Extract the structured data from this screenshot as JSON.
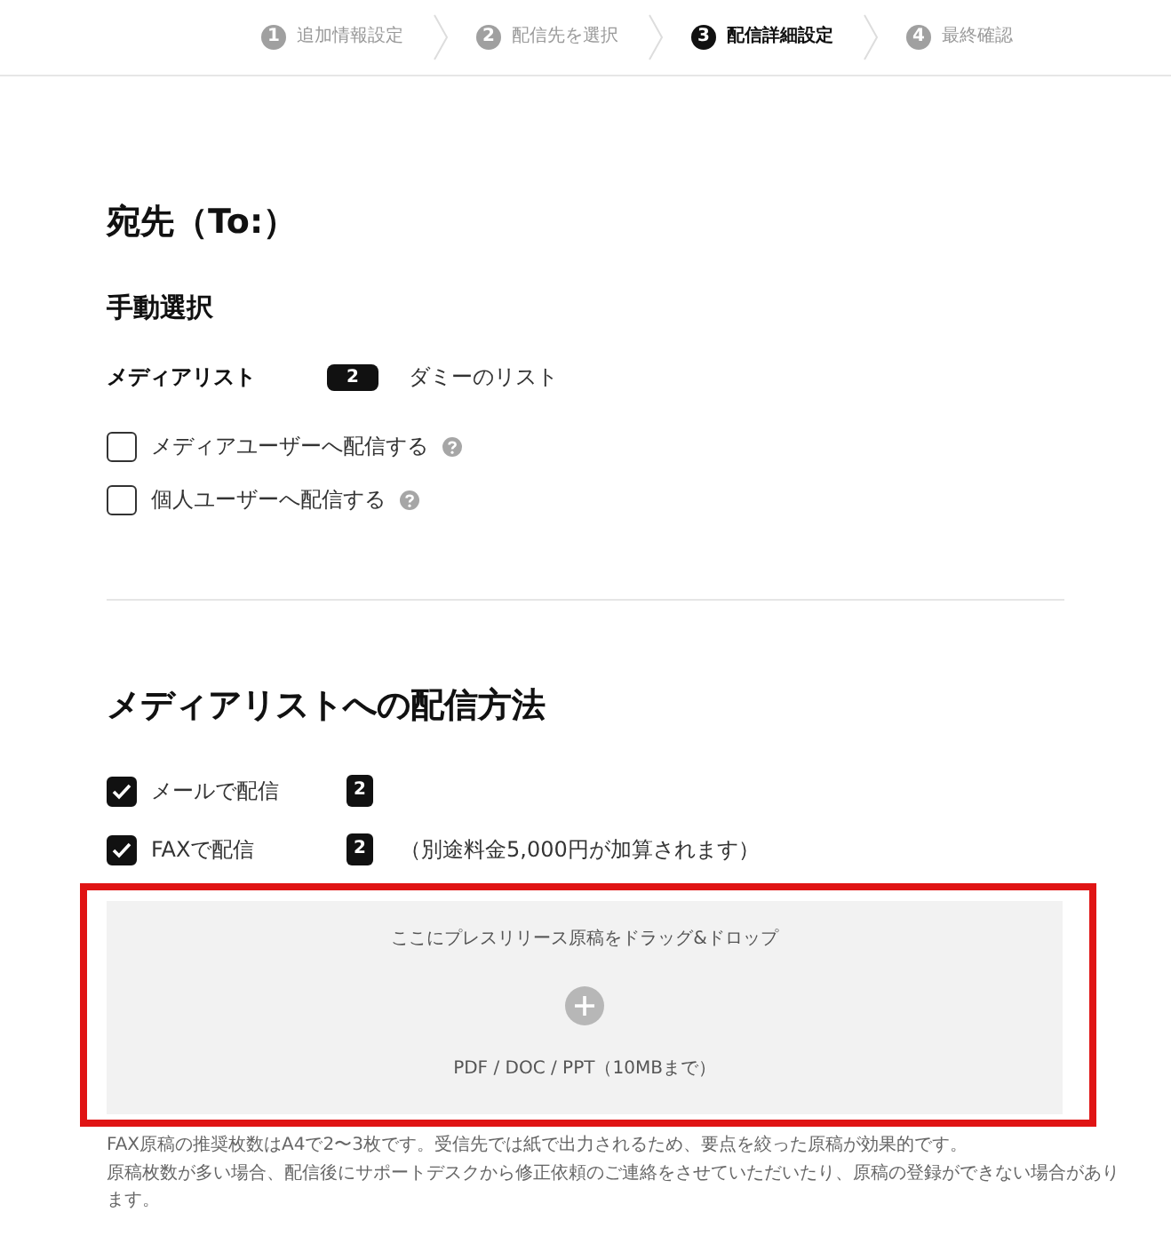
{
  "steps": [
    {
      "number": "1",
      "label": "追加情報設定",
      "selected": false
    },
    {
      "number": "2",
      "label": "配信先を選択",
      "selected": false
    },
    {
      "number": "3",
      "label": "配信詳細設定",
      "selected": true
    },
    {
      "number": "4",
      "label": "最終確認",
      "selected": false
    }
  ],
  "recipient": {
    "title": "宛先（To:）",
    "subtitle": "手動選択",
    "list": {
      "label": "メディアリスト",
      "count": "2",
      "name": "ダミーのリスト"
    },
    "options": [
      {
        "label": "メディアユーザーへ配信する",
        "checked": false,
        "help": true
      },
      {
        "label": "個人ユーザーへ配信する",
        "checked": false,
        "help": true
      }
    ]
  },
  "delivery": {
    "title": "メディアリストへの配信方法",
    "methods": [
      {
        "label": "メールで配信",
        "checked": true,
        "count": "2"
      },
      {
        "label": "FAXで配信",
        "checked": true,
        "count": "2",
        "note": "（別途料金5,000円が加算されます）"
      }
    ]
  },
  "upload": {
    "highlighted": true,
    "prompt": "ここにプレスリリース原稿をドラッグ&ドロップ",
    "formats": "PDF / DOC / PPT（10MBまで）"
  },
  "notes": [
    "FAX原稿の推奨枚数はA4で2〜3枚です。受信先では紙で出力されるため、要点を絞った原稿が効果的です。",
    "原稿枚数が多い場合、配信後にサポートデスクから修正依頼のご連絡をさせていただいたり、原稿の登録ができない場合があります。"
  ]
}
